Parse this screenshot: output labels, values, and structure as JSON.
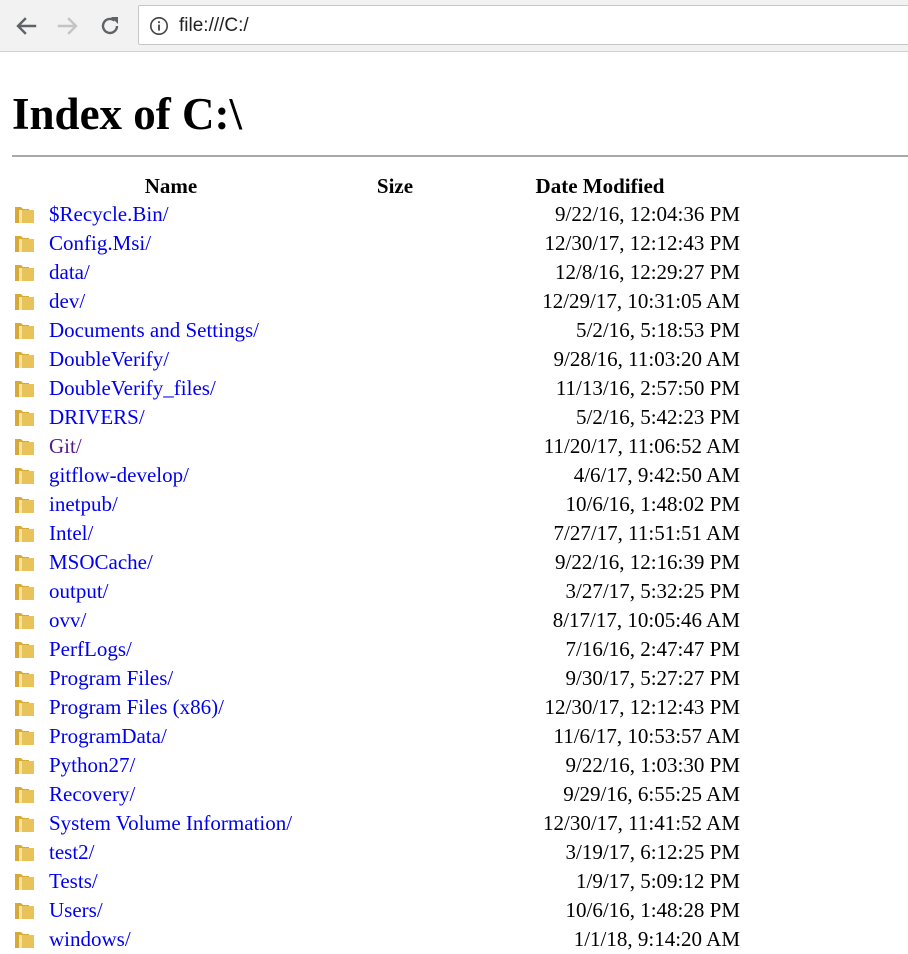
{
  "browser": {
    "url": "file:///C:/",
    "icons": [
      "back-arrow-icon",
      "forward-arrow-icon",
      "reload-icon",
      "info-icon"
    ]
  },
  "page": {
    "title": "Index of C:\\",
    "columns": {
      "name": "Name",
      "size": "Size",
      "date": "Date Modified"
    },
    "entries": [
      {
        "name": "$Recycle.Bin/",
        "date": "9/22/16, 12:04:36 PM"
      },
      {
        "name": "Config.Msi/",
        "date": "12/30/17, 12:12:43 PM"
      },
      {
        "name": "data/",
        "date": "12/8/16, 12:29:27 PM"
      },
      {
        "name": "dev/",
        "date": "12/29/17, 10:31:05 AM"
      },
      {
        "name": "Documents and Settings/",
        "date": "5/2/16, 5:18:53 PM"
      },
      {
        "name": "DoubleVerify/",
        "date": "9/28/16, 11:03:20 AM"
      },
      {
        "name": "DoubleVerify_files/",
        "date": "11/13/16, 2:57:50 PM"
      },
      {
        "name": "DRIVERS/",
        "date": "5/2/16, 5:42:23 PM"
      },
      {
        "name": "Git/",
        "date": "11/20/17, 11:06:52 AM",
        "visited": true
      },
      {
        "name": "gitflow-develop/",
        "date": "4/6/17, 9:42:50 AM"
      },
      {
        "name": "inetpub/",
        "date": "10/6/16, 1:48:02 PM"
      },
      {
        "name": "Intel/",
        "date": "7/27/17, 11:51:51 AM"
      },
      {
        "name": "MSOCache/",
        "date": "9/22/16, 12:16:39 PM"
      },
      {
        "name": "output/",
        "date": "3/27/17, 5:32:25 PM"
      },
      {
        "name": "ovv/",
        "date": "8/17/17, 10:05:46 AM"
      },
      {
        "name": "PerfLogs/",
        "date": "7/16/16, 2:47:47 PM"
      },
      {
        "name": "Program Files/",
        "date": "9/30/17, 5:27:27 PM"
      },
      {
        "name": "Program Files (x86)/",
        "date": "12/30/17, 12:12:43 PM"
      },
      {
        "name": "ProgramData/",
        "date": "11/6/17, 10:53:57 AM"
      },
      {
        "name": "Python27/",
        "date": "9/22/16, 1:03:30 PM"
      },
      {
        "name": "Recovery/",
        "date": "9/29/16, 6:55:25 AM"
      },
      {
        "name": "System Volume Information/",
        "date": "12/30/17, 11:41:52 AM"
      },
      {
        "name": "test2/",
        "date": "3/19/17, 6:12:25 PM"
      },
      {
        "name": "Tests/",
        "date": "1/9/17, 5:09:12 PM"
      },
      {
        "name": "Users/",
        "date": "10/6/16, 1:48:28 PM"
      },
      {
        "name": "windows/",
        "date": "1/1/18, 9:14:20 AM"
      }
    ]
  },
  "colors": {
    "link": "#0000ee",
    "visited": "#551a8b",
    "folder": "#e8c35a"
  }
}
